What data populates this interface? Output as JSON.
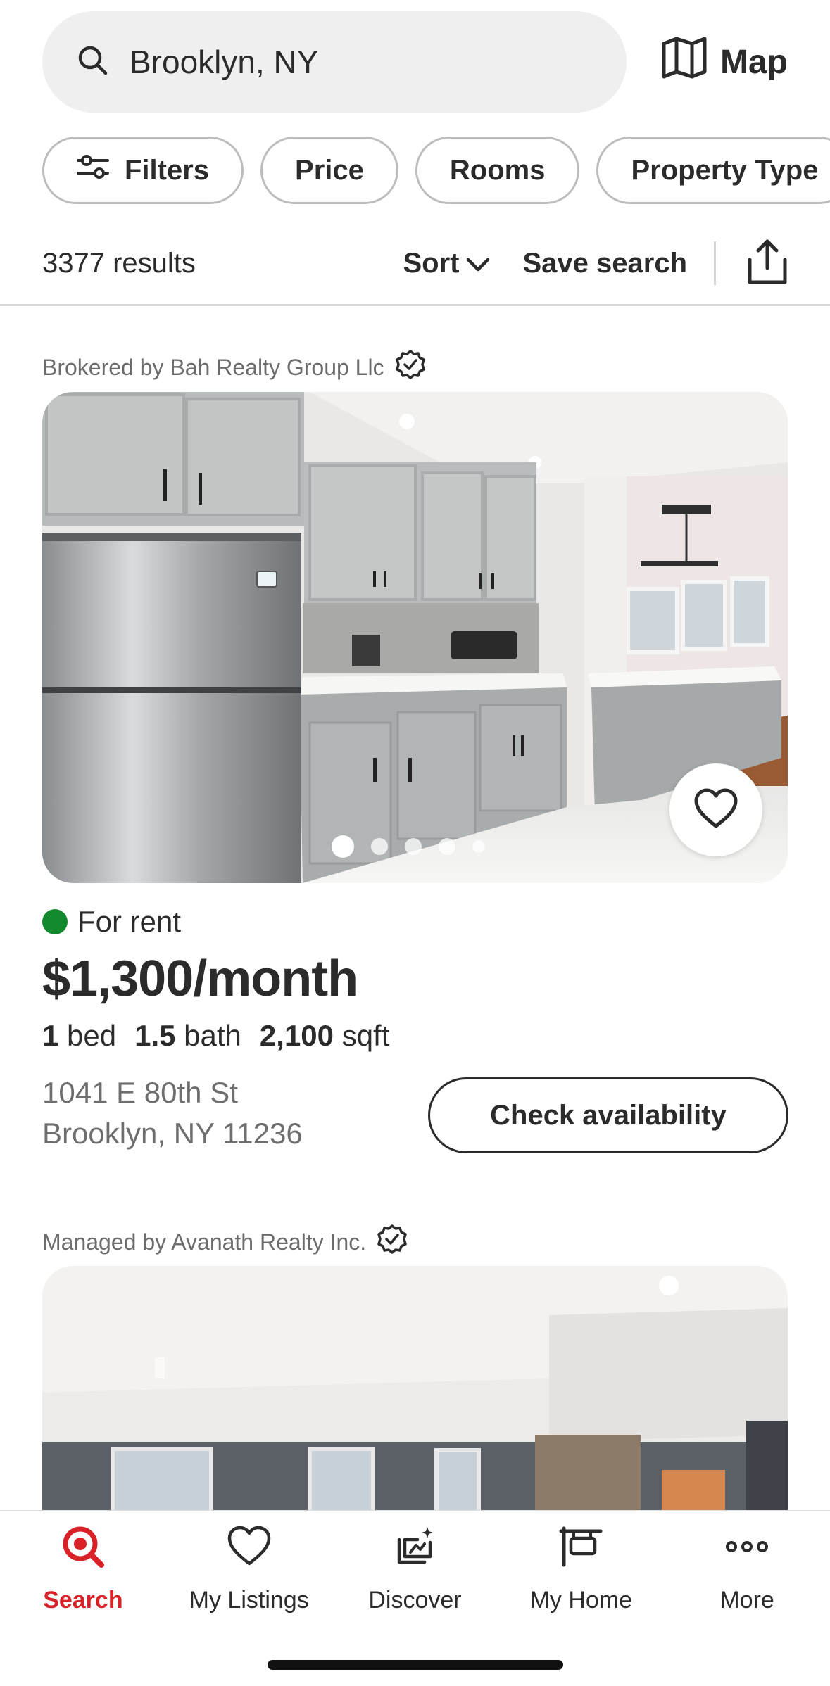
{
  "search": {
    "query": "Brooklyn, NY",
    "map_label": "Map"
  },
  "filters": {
    "chips": [
      "Filters",
      "Price",
      "Rooms",
      "Property Type"
    ]
  },
  "results": {
    "count_text": "3377 results",
    "sort_label": "Sort",
    "save_label": "Save search"
  },
  "listings": [
    {
      "broker": "Brokered by Bah Realty Group Llc",
      "photo_count": 5,
      "status": "For rent",
      "price": "$1,300/month",
      "beds": "1",
      "beds_label": "bed",
      "baths": "1.5",
      "baths_label": "bath",
      "sqft": "2,100",
      "sqft_label": "sqft",
      "address_line1": "1041 E 80th St",
      "address_line2": "Brooklyn, NY 11236",
      "cta": "Check availability"
    },
    {
      "broker": "Managed by Avanath Realty Inc."
    }
  ],
  "bottom_nav": {
    "items": [
      {
        "label": "Search",
        "icon": "search-icon",
        "active": true
      },
      {
        "label": "My Listings",
        "icon": "heart-icon"
      },
      {
        "label": "Discover",
        "icon": "discover-icon"
      },
      {
        "label": "My Home",
        "icon": "home-icon"
      },
      {
        "label": "More",
        "icon": "more-icon"
      }
    ]
  },
  "colors": {
    "brand_red": "#d92228",
    "status_green": "#138a2e",
    "text": "#2b2b2b",
    "muted": "#6e6e6e"
  }
}
